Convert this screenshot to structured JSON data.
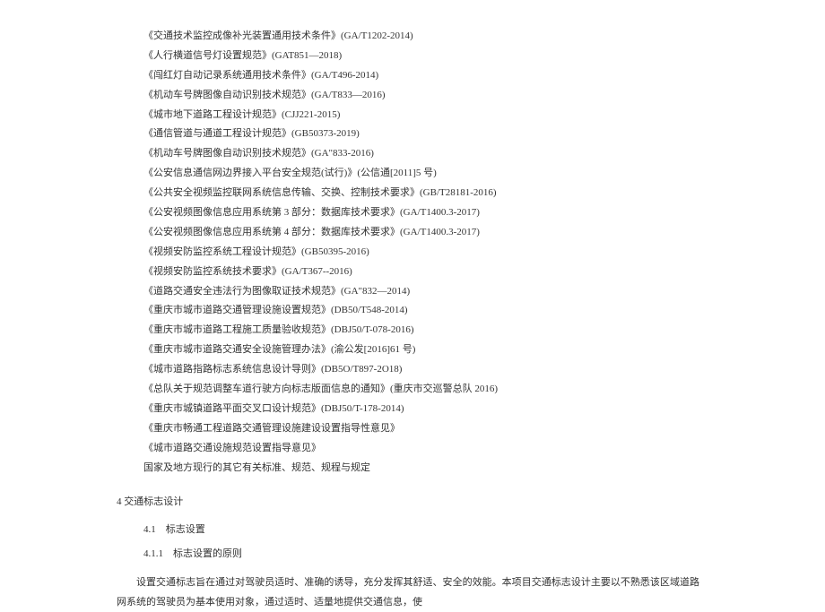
{
  "standards": [
    "《交通技术监控成像补光装置通用技术条件》(GA/T1202-2014)",
    "《人行横道信号灯设置规范》(GAT851—2018)",
    "《闯红灯自动记录系统通用技术条件》(GA/T496-2014)",
    "《机动车号牌图像自动识别技术规范》(GA/T833—2016)",
    "《城市地下道路工程设计规范》(CJJ221-2015)",
    "《通信管道与通道工程设计规范》(GB50373-2019)",
    "《机动车号牌图像自动识别技术规范》(GA\"833-2016)",
    "《公安信息通信网边界接入平台安全规范(试行)》(公信通[2011]5 号)",
    "《公共安全视频监控联网系统信息传输、交换、控制技术要求》(GB/T28181-2016)",
    "《公安视频图像信息应用系统第 3 部分：数据库技术要求》(GA/T1400.3-2017)",
    "《公安视频图像信息应用系统第 4 部分：数据库技术要求》(GA/T1400.3-2017)",
    "《视频安防监控系统工程设计规范》(GB50395-2016)",
    "《视频安防监控系统技术要求》(GA/T367--2016)",
    "《道路交通安全违法行为图像取证技术规范》(GA\"832—2014)",
    "《重庆市城市道路交通管理设施设置规范》(DB50/T548-2014)",
    "《重庆市城市道路工程施工质量验收规范》(DBJ50/T-078-2016)",
    "《重庆市城市道路交通安全设施管理办法》(渝公发[2016]61 号)",
    "《城市道路指路标志系统信息设计导则》(DB5O/T897-2O18)",
    "《总队关于规范调整车道行驶方向标志版面信息的通知》(重庆市交巡警总队 2016)",
    "《重庆市城镇道路平面交叉口设计规范》(DBJ50/T-178-2014)",
    "《重庆市畅通工程道路交通管理设施建设设置指导性意见》",
    "《城市道路交通设施规范设置指导意见》",
    "国家及地方现行的其它有关标准、规范、规程与规定"
  ],
  "section": {
    "number": "4",
    "title": "交通标志设计",
    "sub": {
      "number": "4.1",
      "title": "标志设置",
      "subsub": {
        "number": "4.1.1",
        "title": "标志设置的原则"
      }
    }
  },
  "paragraph": "设置交通标志旨在通过对驾驶员适时、准确的诱导，充分发挥其舒适、安全的效能。本项目交通标志设计主要以不熟悉该区域道路网系统的驾驶员为基本使用对象，通过适时、适量地提供交通信息，使"
}
